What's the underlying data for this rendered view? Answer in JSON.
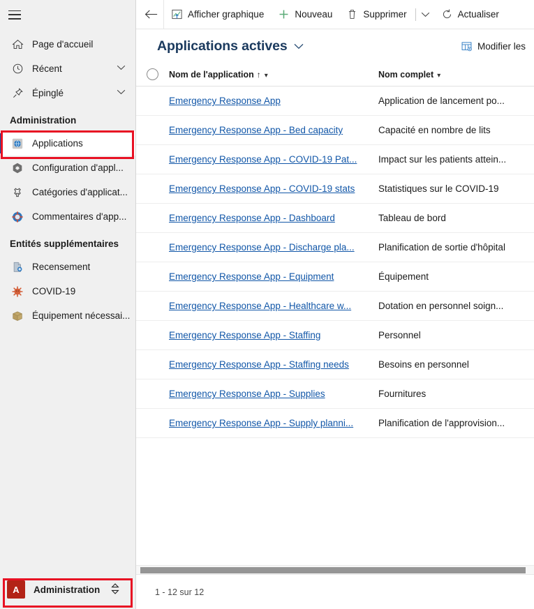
{
  "sidebar": {
    "hamburger_label": "Menu",
    "nav_top": [
      {
        "label": "Page d'accueil",
        "icon": "home-icon",
        "chevron": false
      },
      {
        "label": "Récent",
        "icon": "clock-icon",
        "chevron": true
      },
      {
        "label": "Épinglé",
        "icon": "pin-icon",
        "chevron": true
      }
    ],
    "group_admin": {
      "title": "Administration",
      "items": [
        {
          "label": "Applications",
          "icon": "globe-app-icon",
          "selected": true
        },
        {
          "label": "Configuration d'appl...",
          "icon": "gear-hex-icon",
          "selected": false
        },
        {
          "label": "Catégories d'applicat...",
          "icon": "puzzle-icon",
          "selected": false
        },
        {
          "label": "Commentaires d'app...",
          "icon": "feedback-icon",
          "selected": false
        }
      ]
    },
    "group_entities": {
      "title": "Entités supplémentaires",
      "items": [
        {
          "label": "Recensement",
          "icon": "census-icon"
        },
        {
          "label": "COVID-19",
          "icon": "virus-icon"
        },
        {
          "label": "Équipement nécessai...",
          "icon": "box-icon"
        }
      ]
    },
    "footer": {
      "badge_letter": "A",
      "env_name": "Administration",
      "switch_icon": "environment-switch-icon"
    }
  },
  "toolbar": {
    "back_icon": "back-arrow-icon",
    "buttons": [
      {
        "label": "Afficher graphique",
        "icon": "chart-icon"
      },
      {
        "label": "Nouveau",
        "icon": "plus-icon"
      },
      {
        "label": "Supprimer",
        "icon": "trash-icon"
      }
    ],
    "overflow_caret_icon": "chevron-down-icon",
    "refresh": {
      "label": "Actualiser",
      "icon": "refresh-icon"
    }
  },
  "view": {
    "title": "Applications actives",
    "title_caret_icon": "chevron-down-icon",
    "edit_columns": {
      "label": "Modifier les",
      "icon": "edit-columns-icon"
    }
  },
  "grid": {
    "select_all_icon": "select-all-circle",
    "columns": [
      {
        "label": "Nom de l'application",
        "sort": "↑",
        "caret_icon": "chevron-down-icon"
      },
      {
        "label": "Nom complet",
        "sort": "",
        "caret_icon": "chevron-down-icon"
      }
    ],
    "rows": [
      {
        "name": "Emergency Response App",
        "fullname": "Application de lancement po..."
      },
      {
        "name": "Emergency Response App - Bed capacity",
        "fullname": "Capacité en nombre de lits"
      },
      {
        "name": "Emergency Response App - COVID-19 Pat...",
        "fullname": "Impact sur les patients attein..."
      },
      {
        "name": "Emergency Response App - COVID-19 stats",
        "fullname": "Statistiques sur le COVID-19"
      },
      {
        "name": "Emergency Response App - Dashboard",
        "fullname": "Tableau de bord"
      },
      {
        "name": "Emergency Response App - Discharge pla...",
        "fullname": "Planification de sortie d'hôpital"
      },
      {
        "name": "Emergency Response App - Equipment",
        "fullname": "Équipement"
      },
      {
        "name": "Emergency Response App - Healthcare w...",
        "fullname": "Dotation en personnel soign..."
      },
      {
        "name": "Emergency Response App - Staffing",
        "fullname": "Personnel"
      },
      {
        "name": "Emergency Response App - Staffing needs",
        "fullname": "Besoins en personnel"
      },
      {
        "name": "Emergency Response App - Supplies",
        "fullname": "Fournitures"
      },
      {
        "name": "Emergency Response App - Supply planni...",
        "fullname": "Planification de l'approvision..."
      }
    ],
    "footer_count": "1 - 12 sur 12"
  },
  "colors": {
    "link": "#1257a8",
    "title": "#1b3a5e",
    "highlight_red": "#e81123",
    "env_badge": "#b32317",
    "sidebar_bg": "#f0f0f0"
  }
}
